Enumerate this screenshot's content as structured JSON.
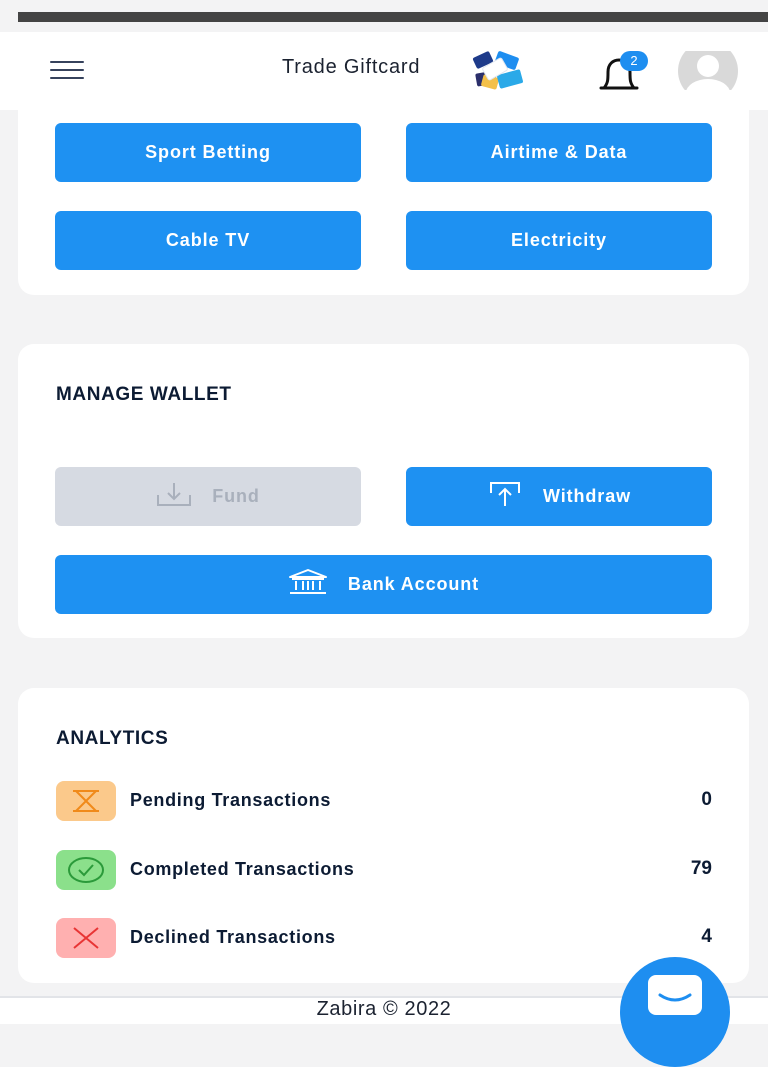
{
  "header": {
    "title": "Trade Giftcard",
    "notification_count": "2",
    "menu_icon": "hamburger-menu-icon",
    "bell_icon": "bell-icon",
    "avatar_icon": "user-avatar-icon"
  },
  "services": {
    "buttons": [
      {
        "label": "Sport Betting"
      },
      {
        "label": "Airtime & Data"
      },
      {
        "label": "Cable TV"
      },
      {
        "label": "Electricity"
      }
    ]
  },
  "wallet": {
    "title": "MANAGE WALLET",
    "fund_label": "Fund",
    "withdraw_label": "Withdraw",
    "bank_label": "Bank Account"
  },
  "analytics": {
    "title": "ANALYTICS",
    "rows": [
      {
        "label": "Pending Transactions",
        "value": "0",
        "icon": "hourglass-icon"
      },
      {
        "label": "Completed Transactions",
        "value": "79",
        "icon": "check-circle-icon"
      },
      {
        "label": "Declined Transactions",
        "value": "4",
        "icon": "x-icon"
      }
    ]
  },
  "footer": {
    "text": "Zabira © 2022"
  },
  "colors": {
    "primary": "#1e91f2",
    "disabled": "#d6dae2",
    "pending_bg": "#fbc98b",
    "completed_bg": "#8be08b",
    "declined_bg": "#ffb0b0"
  }
}
